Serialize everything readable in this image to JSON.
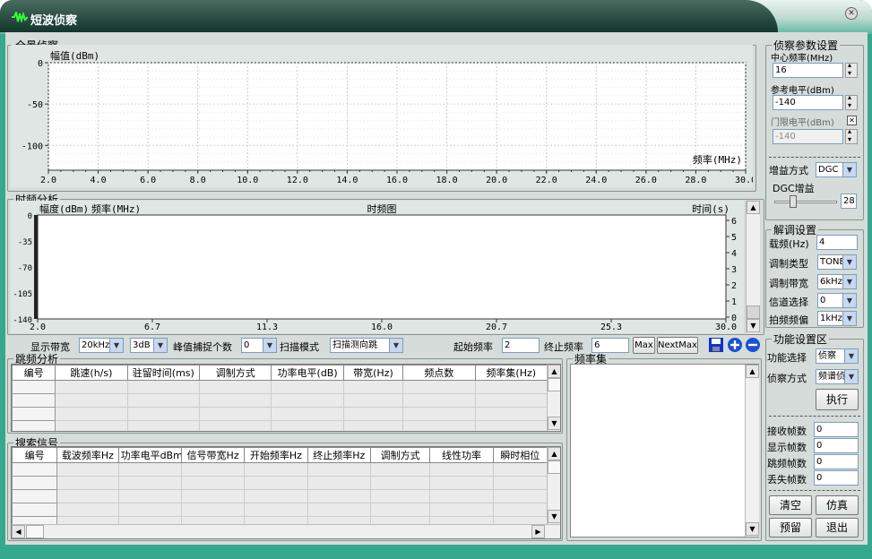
{
  "window": {
    "title": "短波侦察"
  },
  "panorama": {
    "legend": "全景侦察",
    "ylabel": "幅值(dBm)",
    "xlabel": "频率(MHz)"
  },
  "timefreq": {
    "legend": "时频分析",
    "ylabel": "幅度(dBm)",
    "xlabel": "频率(MHz)",
    "title": "时频图",
    "time_label": "时间(s)"
  },
  "controls": {
    "display_bw_label": "显示带宽",
    "display_bw": "20kHz",
    "db_select": "3dB",
    "peak_label": "峰值捕捉个数",
    "peak_value": "0",
    "scan_mode_label": "扫描模式",
    "scan_mode": "扫描测向跳",
    "start_freq_label": "起始频率",
    "start_freq": "2",
    "stop_freq_label": "终止频率",
    "stop_freq": "6",
    "max_btn": "Max",
    "nextmax_btn": "NextMax"
  },
  "hop": {
    "legend": "跳频分析",
    "columns": [
      "编号",
      "跳速(h/s)",
      "驻留时间(ms)",
      "调制方式",
      "功率电平(dB)",
      "带宽(Hz)",
      "频点数",
      "频率集(Hz)"
    ]
  },
  "search": {
    "legend": "搜索信号",
    "columns": [
      "编号",
      "载波频率Hz",
      "功率电平dBm",
      "信号带宽Hz",
      "开始频率Hz",
      "终止频率Hz",
      "调制方式",
      "线性功率",
      "瞬时相位"
    ]
  },
  "freqset": {
    "legend": "频率集"
  },
  "recon_params": {
    "legend": "侦察参数设置",
    "center_label": "中心频率(MHz)",
    "center_value": "16",
    "ref_label": "参考电平(dBm)",
    "ref_value": "-140",
    "threshold_label": "门限电平(dBm)",
    "threshold_value": "-140",
    "gain_mode_label": "增益方式",
    "gain_mode": "DGC",
    "dgc_label": "DGC增益",
    "dgc_value": "28"
  },
  "demod": {
    "legend": "解调设置",
    "carrier_label": "载频(Hz)",
    "carrier_value": "4",
    "mod_type_label": "调制类型",
    "mod_type": "TONE",
    "mod_bw_label": "调制带宽",
    "mod_bw": "6kHz",
    "channel_label": "信道选择",
    "channel": "0",
    "beat_label": "拍频频偏",
    "beat": "1kHz"
  },
  "func": {
    "legend": "功能设置区",
    "select_label": "功能选择",
    "select_value": "侦察",
    "mode_label": "侦察方式",
    "mode_value": "频谱侦",
    "exec_btn": "执行",
    "recv_label": "接收帧数",
    "recv": "0",
    "show_label": "显示帧数",
    "show": "0",
    "hop_label": "跳频帧数",
    "hop": "0",
    "lost_label": "丢失帧数",
    "lost": "0",
    "clear_btn": "清空",
    "sim_btn": "仿真",
    "reserve_btn": "预留",
    "exit_btn": "退出"
  },
  "chart_data": [
    {
      "type": "line",
      "title": "",
      "xlabel": "频率(MHz)",
      "ylabel": "幅值(dBm)",
      "xlim": [
        2.0,
        30.0
      ],
      "ylim": [
        -130,
        0
      ],
      "x_ticks": [
        "2.0",
        "4.0",
        "6.0",
        "8.0",
        "10.0",
        "12.0",
        "14.0",
        "16.0",
        "18.0",
        "20.0",
        "22.0",
        "24.0",
        "26.0",
        "28.0",
        "30.0"
      ],
      "y_ticks": [
        "0",
        "-50",
        "-100"
      ],
      "series": [],
      "grid": true
    },
    {
      "type": "heatmap",
      "title": "时频图",
      "xlabel": "频率(MHz)",
      "ylabel": "幅度(dBm)",
      "xlim": [
        2.0,
        30.0
      ],
      "x_ticks": [
        "2.0",
        "6.7",
        "11.3",
        "16.0",
        "20.7",
        "25.3",
        "30.0"
      ],
      "y_ticks": [
        "0",
        "-35",
        "-70",
        "-105",
        "-140"
      ],
      "time_ticks": [
        "6",
        "5",
        "4",
        "3",
        "2",
        "1",
        "0"
      ],
      "series": []
    }
  ]
}
